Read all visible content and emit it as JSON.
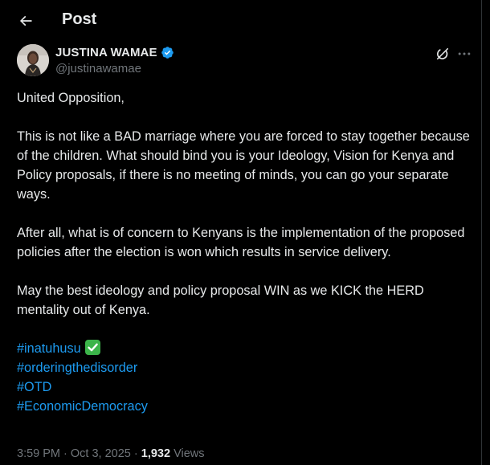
{
  "header": {
    "title": "Post"
  },
  "author": {
    "display_name": "JUSTINA WAMAE",
    "handle": "@justinawamae",
    "verified": true
  },
  "post": {
    "paragraphs": [
      "United Opposition,",
      "This is not like a BAD marriage where you are forced to stay together because of the children. What should bind you is your Ideology, Vision for Kenya and Policy proposals, if there is no meeting of minds, you can go your separate ways.",
      "After all, what is of concern to Kenyans is the  implementation of the proposed policies  after the election is won which results in service delivery.",
      "May the best ideology and policy proposal WIN as we KICK the HERD mentality out of Kenya."
    ],
    "hashtags": [
      "#inatuhusu",
      "#orderingthedisorder",
      "#OTD",
      "#EconomicDemocracy"
    ]
  },
  "meta": {
    "time": "3:59 PM",
    "separator": " · ",
    "date": "Oct 3, 2025",
    "views_count": "1,932",
    "views_label": " Views"
  },
  "icons": {
    "back": "arrow-left-icon",
    "verified": "verified-badge-icon",
    "grok": "grok-icon",
    "more": "more-horizontal-icon",
    "check": "check-mark-emoji"
  },
  "colors": {
    "background": "#000000",
    "text": "#e7e9ea",
    "secondary": "#71767b",
    "link": "#1d9bf0",
    "verified": "#1d9bf0",
    "border": "#2f3336"
  }
}
